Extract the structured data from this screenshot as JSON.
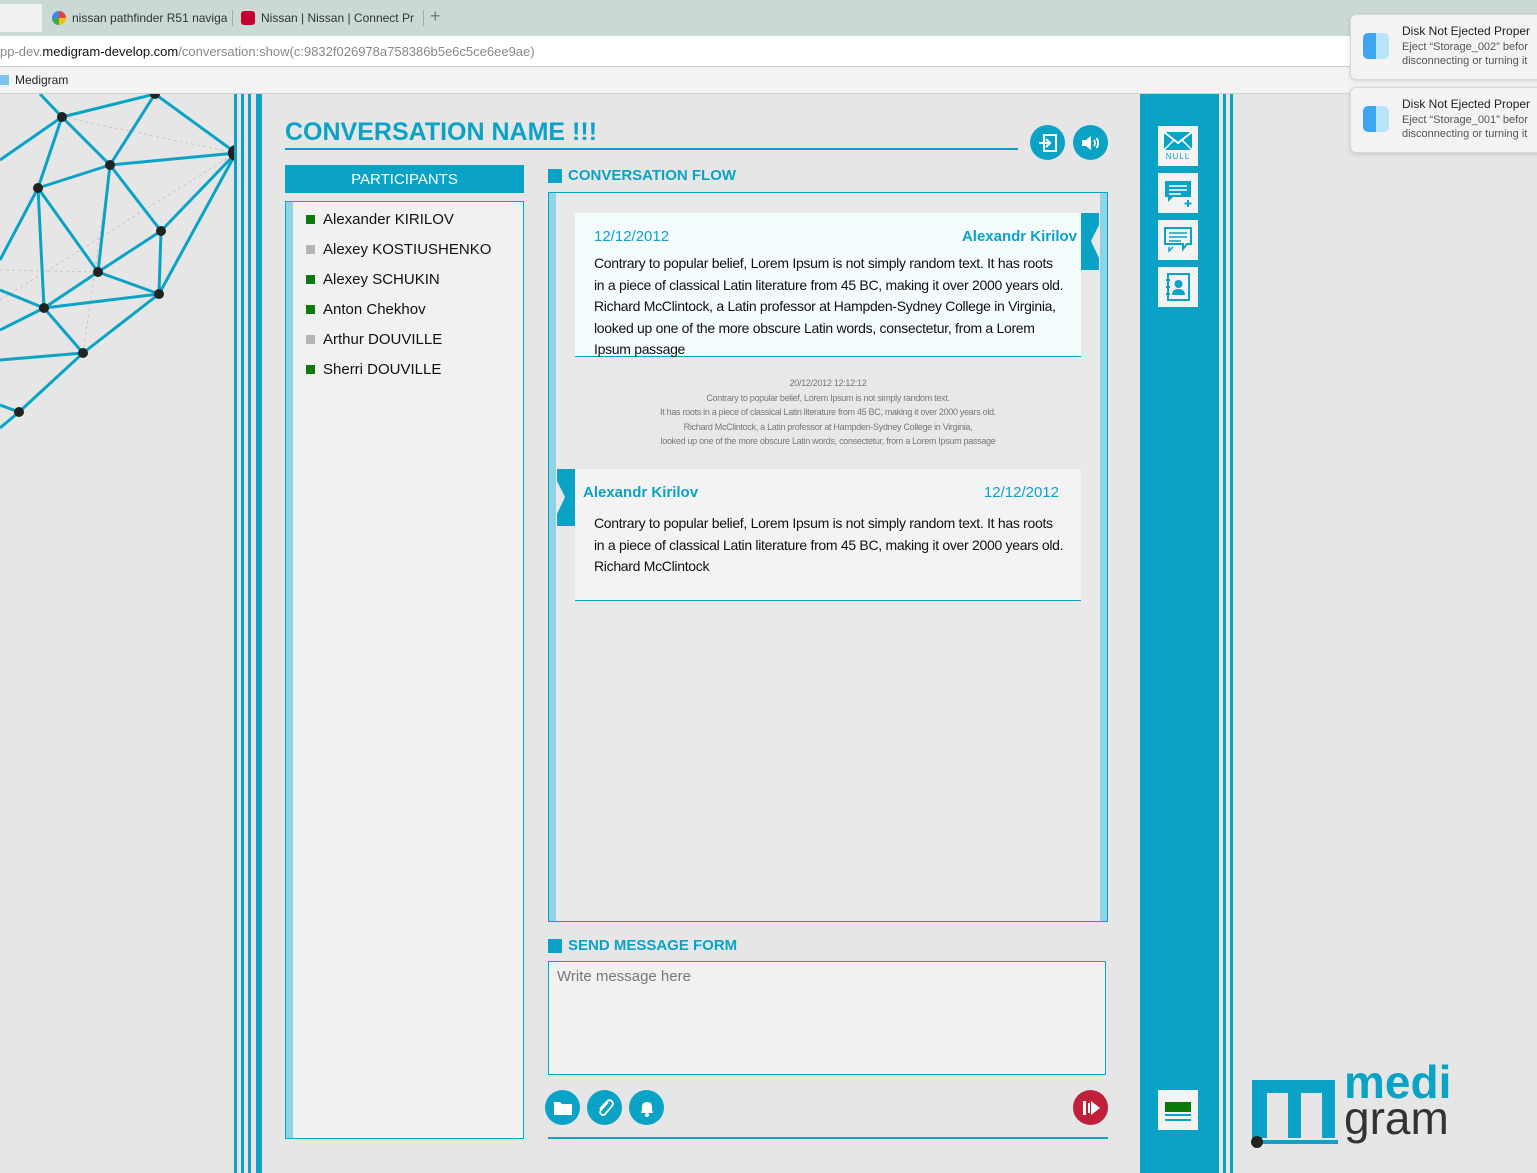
{
  "browser": {
    "tabs": [
      {
        "label": "nissan pathfinder R51 naviga",
        "icon": "google-icon"
      },
      {
        "label": "Nissan | Nissan | Connect Pr",
        "icon": "nissan-icon"
      }
    ],
    "new_tab": "+",
    "url_prefix": "pp-dev.",
    "url_host": "medigram-develop.com",
    "url_path": "/conversation:show(c:9832f026978a758386b5e6c5ce6ee9ae)",
    "bookmark": "Medigram"
  },
  "notifications": [
    {
      "title": "Disk Not Ejected Proper",
      "line1": "Eject “Storage_002” befor",
      "line2": "disconnecting or turning it"
    },
    {
      "title": "Disk Not Ejected Proper",
      "line1": "Eject “Storage_001” befor",
      "line2": "disconnecting or turning it"
    }
  ],
  "conversation": {
    "title": "CONVERSATION NAME !!!"
  },
  "participants": {
    "header": "PARTICIPANTS",
    "items": [
      {
        "name": "Alexander KIRILOV",
        "status_color": "#0a7a0a"
      },
      {
        "name": "Alexey KOSTIUSHENKO",
        "status_color": "#b5b5b5"
      },
      {
        "name": "Alexey SCHUKIN",
        "status_color": "#0a7a0a"
      },
      {
        "name": "Anton Chekhov",
        "status_color": "#0a7a0a"
      },
      {
        "name": "Arthur DOUVILLE",
        "status_color": "#b5b5b5"
      },
      {
        "name": "Sherri DOUVILLE",
        "status_color": "#0a7a0a"
      }
    ]
  },
  "flow": {
    "label": "CONVERSATION FLOW",
    "messages": [
      {
        "date": "12/12/2012",
        "author": "Alexandr Kirilov",
        "body": "Contrary to popular belief, Lorem Ipsum is not simply random text. It has roots in a piece of classical Latin literature from 45 BC, making it over 2000 years old. Richard McClintock, a Latin professor at Hampden-Sydney College in Virginia, looked up one of the more obscure Latin words, consectetur, from a Lorem Ipsum passage"
      },
      {
        "date": "12/12/2012",
        "author": "Alexandr Kirilov",
        "body": "Contrary to popular belief, Lorem Ipsum is not simply random text. It has roots in a piece of classical Latin literature from 45 BC, making it over 2000 years old. Richard McClintock"
      }
    ],
    "system_note": {
      "timestamp": "20/12/2012 12:12:12",
      "lines": [
        "Contrary to popular belief, Lorem Ipsum is not simply random text.",
        "It has roots in a piece of classical Latin literature from 45 BC, making it over 2000 years old.",
        "Richard McClintock, a Latin professor at Hampden-Sydney College in Virginia,",
        "looked up one of the more obscure Latin words, consectetur, from a Lorem Ipsum passage"
      ]
    }
  },
  "send_form": {
    "label": "SEND MESSAGE FORM",
    "placeholder": "Write message here"
  },
  "sidebar": {
    "inbox_badge": "NULL"
  },
  "logo": {
    "line1": "medi",
    "line2": "gram"
  },
  "colors": {
    "accent": "#0aa3c6",
    "light_accent": "#8fd3e6",
    "online": "#0a7a0a",
    "offline": "#b5b5b5",
    "record": "#c0203a"
  }
}
